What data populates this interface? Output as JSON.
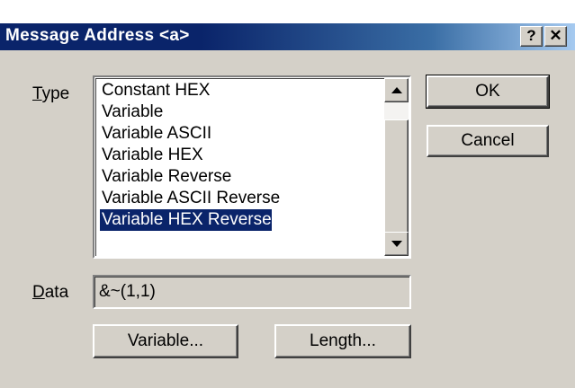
{
  "window": {
    "title": "Message Address <a>",
    "help_button": "?",
    "close_button": "✕"
  },
  "type_label": {
    "accel": "T",
    "rest": "ype"
  },
  "type_list": {
    "items": [
      "Constant HEX",
      "Variable",
      "Variable ASCII",
      "Variable HEX",
      "Variable Reverse",
      "Variable ASCII Reverse",
      "Variable HEX Reverse"
    ],
    "selected_index": 6
  },
  "data_label": {
    "accel": "D",
    "rest": "ata"
  },
  "data_field": {
    "value": "&~(1,1)"
  },
  "buttons": {
    "ok": "OK",
    "cancel": "Cancel",
    "variable": "Variable...",
    "length": "Length..."
  },
  "colors": {
    "face": "#d4d0c8",
    "title_active": "#0a246a",
    "selection": "#0a246a"
  },
  "icons": {
    "scroll_up": "triangle-up-icon",
    "scroll_down": "triangle-down-icon"
  }
}
